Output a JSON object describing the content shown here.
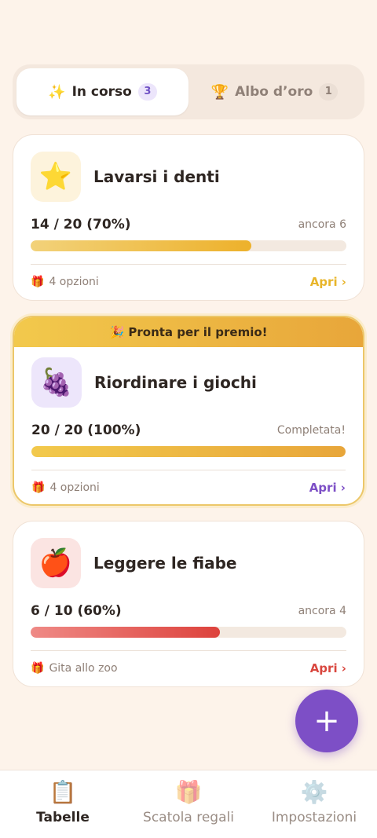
{
  "tabs": [
    {
      "icon": "✨",
      "label": "In corso",
      "count": "3"
    },
    {
      "icon": "🏆",
      "label": "Albo d’oro",
      "count": "1"
    }
  ],
  "cards": [
    {
      "emoji": "⭐",
      "title": "Lavarsi i denti",
      "count": "14 / 20 (70%)",
      "progress": 0.7,
      "remaining": "ancora 6",
      "reward_icon": "🎁",
      "reward": "4 opzioni",
      "open": "Apri ›",
      "accent": "#e8b52a"
    },
    {
      "ready_banner": "🎉 Pronta per il premio!",
      "emoji": "🍇",
      "title": "Riordinare i giochi",
      "count": "20 / 20 (100%)",
      "progress": 1.0,
      "remaining": "Completata!",
      "reward_icon": "🎁",
      "reward": "4 opzioni",
      "open": "Apri ›",
      "accent": "#7d4fc6"
    },
    {
      "emoji": "🍎",
      "title": "Leggere le fiabe",
      "count": "6 / 10 (60%)",
      "progress": 0.6,
      "remaining": "ancora 4",
      "reward_icon": "🎁",
      "reward": "Gita allo zoo",
      "open": "Apri ›",
      "accent": "#d9473f"
    }
  ],
  "fab": {
    "label": "+"
  },
  "nav": [
    {
      "icon": "📋",
      "label": "Tabelle"
    },
    {
      "icon": "🎁",
      "label": "Scatola regali"
    },
    {
      "icon": "⚙️",
      "label": "Impostazioni"
    }
  ],
  "colors": {
    "background": "#fdf3ea",
    "purple": "#7d4fc6",
    "gold": "#e8b52a",
    "red": "#d9473f"
  }
}
